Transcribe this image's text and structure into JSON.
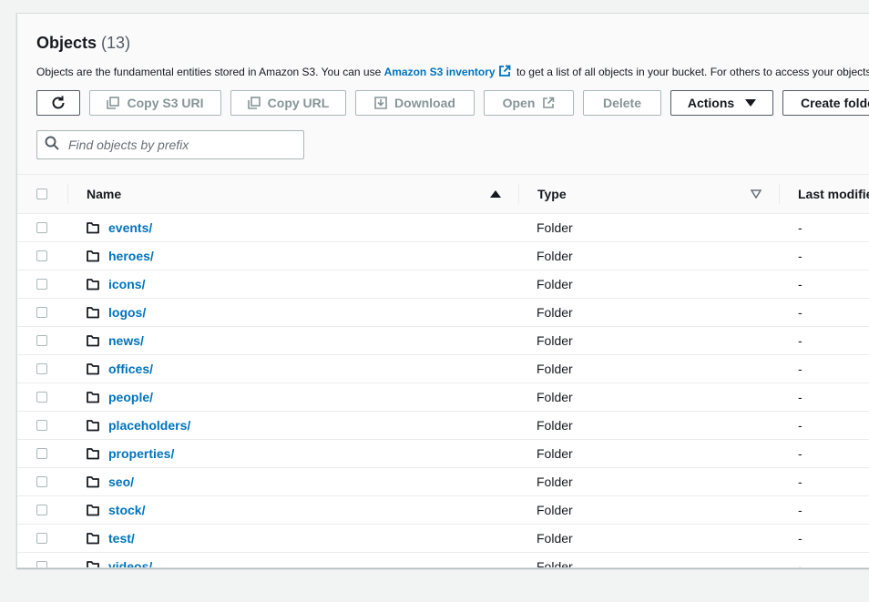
{
  "objects": {
    "title": "Objects",
    "count": "(13)",
    "description_before": "Objects are the fundamental entities stored in Amazon S3. You can use ",
    "description_link": "Amazon S3 inventory",
    "description_after": " to get a list of all objects in your bucket. For others to access your objects, you'll need to explicitly grant them permissions."
  },
  "toolbar": {
    "copy_s3_uri": "Copy S3 URI",
    "copy_url": "Copy URL",
    "download": "Download",
    "open": "Open",
    "delete": "Delete",
    "actions": "Actions",
    "create_folder": "Create folder"
  },
  "search": {
    "placeholder": "Find objects by prefix"
  },
  "table": {
    "columns": {
      "name": "Name",
      "type": "Type",
      "last_modified": "Last modified"
    },
    "rows": [
      {
        "name": "events/",
        "type": "Folder",
        "last_modified": "-"
      },
      {
        "name": "heroes/",
        "type": "Folder",
        "last_modified": "-"
      },
      {
        "name": "icons/",
        "type": "Folder",
        "last_modified": "-"
      },
      {
        "name": "logos/",
        "type": "Folder",
        "last_modified": "-"
      },
      {
        "name": "news/",
        "type": "Folder",
        "last_modified": "-"
      },
      {
        "name": "offices/",
        "type": "Folder",
        "last_modified": "-"
      },
      {
        "name": "people/",
        "type": "Folder",
        "last_modified": "-"
      },
      {
        "name": "placeholders/",
        "type": "Folder",
        "last_modified": "-"
      },
      {
        "name": "properties/",
        "type": "Folder",
        "last_modified": "-"
      },
      {
        "name": "seo/",
        "type": "Folder",
        "last_modified": "-"
      },
      {
        "name": "stock/",
        "type": "Folder",
        "last_modified": "-"
      },
      {
        "name": "test/",
        "type": "Folder",
        "last_modified": "-"
      },
      {
        "name": "videos/",
        "type": "Folder",
        "last_modified": "-"
      }
    ]
  },
  "colors": {
    "link": "#0073bb",
    "disabled_text": "#879596",
    "border": "#aab7b8"
  }
}
